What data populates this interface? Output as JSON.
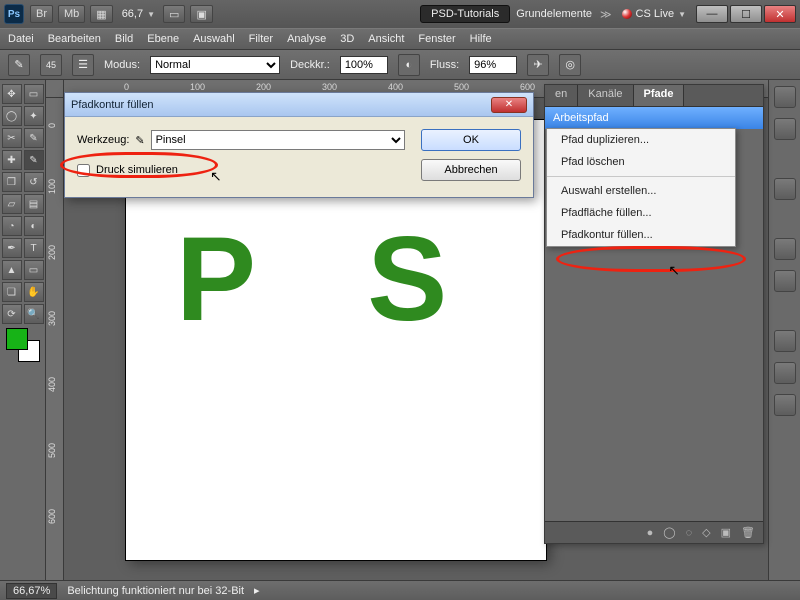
{
  "title": {
    "zoom": "66,7",
    "doc_active": "PSD-Tutorials",
    "doc_other": "Grundelemente",
    "cslive": "CS Live",
    "btn_br": "Br",
    "btn_mb": "Mb"
  },
  "menu": [
    "Datei",
    "Bearbeiten",
    "Bild",
    "Ebene",
    "Auswahl",
    "Filter",
    "Analyse",
    "3D",
    "Ansicht",
    "Fenster",
    "Hilfe"
  ],
  "opt": {
    "brush_size": "45",
    "mode_label": "Modus:",
    "mode_value": "Normal",
    "opacity_label": "Deckkr.:",
    "opacity_value": "100%",
    "flow_label": "Fluss:",
    "flow_value": "96%"
  },
  "ruler_h": [
    "0",
    "100",
    "200",
    "300",
    "400",
    "500",
    "600"
  ],
  "ruler_v": [
    "0",
    "100",
    "200",
    "300",
    "400",
    "500",
    "600"
  ],
  "canvas": {
    "text": "P S"
  },
  "panels": {
    "tabs": [
      "en",
      "Kanäle",
      "Pfade"
    ],
    "active_tab": 2,
    "path_row": "Arbeitspfad"
  },
  "context_menu": {
    "items": [
      "Pfad duplizieren...",
      "Pfad löschen",
      "",
      "Auswahl erstellen...",
      "Pfadfläche füllen...",
      "Pfadkontur füllen..."
    ]
  },
  "dialog": {
    "title": "Pfadkontur füllen",
    "tool_label": "Werkzeug:",
    "tool_value": "Pinsel",
    "simulate_label": "Druck simulieren",
    "ok": "OK",
    "cancel": "Abbrechen"
  },
  "status": {
    "zoom": "66,67%",
    "msg": "Belichtung funktioniert nur bei 32-Bit"
  }
}
